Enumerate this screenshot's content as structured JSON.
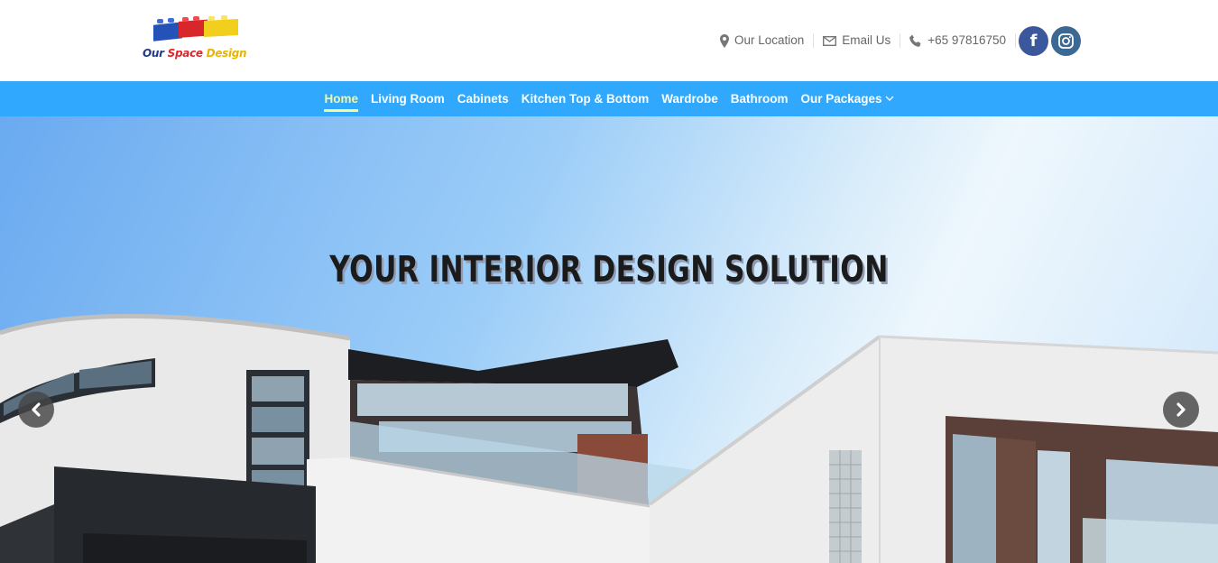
{
  "brand": {
    "name_part1": "Our ",
    "name_part2": "Space",
    "name_part3": " Design",
    "brick_colors": [
      "#2452b8",
      "#d8262c",
      "#f2cf1c"
    ]
  },
  "header": {
    "location_label": "Our Location",
    "email_label": "Email Us",
    "phone": "+65 97816750",
    "social": [
      {
        "name": "facebook",
        "glyph": "f",
        "color": "#3a589b"
      },
      {
        "name": "instagram",
        "icon": "instagram-icon",
        "color": "#3b6994"
      }
    ]
  },
  "nav": {
    "items": [
      {
        "label": "Home",
        "active": true
      },
      {
        "label": "Living Room"
      },
      {
        "label": "Cabinets"
      },
      {
        "label": "Kitchen Top & Bottom"
      },
      {
        "label": "Wardrobe"
      },
      {
        "label": "Bathroom"
      },
      {
        "label": "Our Packages",
        "has_dropdown": true
      }
    ],
    "bar_color": "#2fa8fd",
    "active_color": "#f7f79c"
  },
  "hero": {
    "title": "YOUR INTERIOR DESIGN SOLUTION",
    "prev_icon": "chevron-left-icon",
    "next_icon": "chevron-right-icon"
  }
}
